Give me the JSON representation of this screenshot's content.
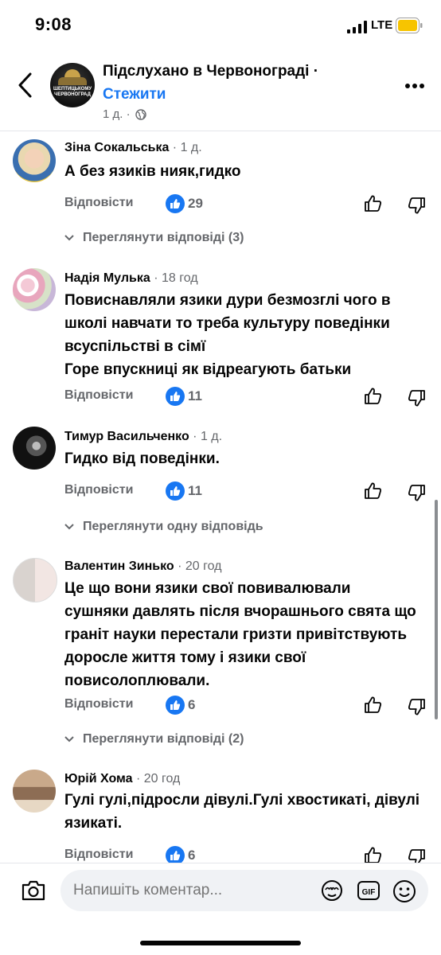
{
  "status_bar": {
    "time": "9:08",
    "network": "LTE"
  },
  "header": {
    "group_name": "Підслухано в Червонограді ·",
    "follow_label": "Стежити",
    "time_ago": "1 д. ·",
    "avatar_text": "ШЕПТИЦЬКОМУ ЧЕРВОНОГРАД"
  },
  "comments": [
    {
      "author": "Зіна Сокальська",
      "time_ago": " · 1 д.",
      "text": "А без язиків нияк,гидко",
      "reply_label": "Відповісти",
      "likes": "29",
      "view_replies": "Переглянути відповіді (3)"
    },
    {
      "author": "Надія Мулька",
      "time_ago": " · 18 год",
      "text": "Повиснавляли язики дури безмозглі чого в школі навчати то треба культуру поведінки всуспільстві в сімї\nГоре впускниці як відреагують батьки",
      "reply_label": "Відповісти",
      "likes": "11"
    },
    {
      "author": "Тимур Васильченко",
      "time_ago": " · 1 д.",
      "text": "Гидко від поведінки.",
      "reply_label": "Відповісти",
      "likes": "11",
      "view_replies": "Переглянути одну відповідь"
    },
    {
      "author": "Валентин Зинько",
      "time_ago": " · 20 год",
      "text": "Це що вони язики свої повивалювали сушняки давлять після вчорашнього свята що граніт науки перестали гризти привітствують доросле життя тому і язики свої повисолоплювали.",
      "reply_label": "Відповісти",
      "likes": "6",
      "view_replies": "Переглянути відповіді (2)"
    },
    {
      "author": "Юрій Хома",
      "time_ago": " · 20 год",
      "text": "Гулі гулі,підросли дівулі.Гулі хвостикаті, дівулі язикаті.",
      "reply_label": "Відповісти",
      "likes": "6"
    }
  ],
  "composer": {
    "placeholder": "Напишіть коментар..."
  },
  "colors": {
    "accent": "#1877f2",
    "secondary_text": "#65676b",
    "battery": "#f7c400"
  },
  "icons": [
    "back-arrow-icon",
    "globe-icon",
    "more-icon",
    "like-icon",
    "thumb-up-icon",
    "thumb-down-icon",
    "chevron-down-icon",
    "camera-icon",
    "avatar-sticker-icon",
    "gif-icon",
    "emoji-icon"
  ]
}
